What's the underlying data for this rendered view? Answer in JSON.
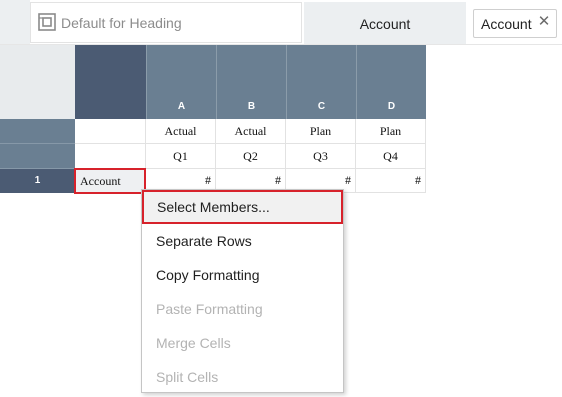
{
  "toolbar": {
    "format_label": "Default for Heading",
    "pov_tab_label": "Account",
    "pov_chip_label": "Account",
    "pov_chip_close": "✕"
  },
  "grid": {
    "column_letters": [
      "A",
      "B",
      "C",
      "D"
    ],
    "header_rows": [
      [
        "Actual",
        "Actual",
        "Plan",
        "Plan"
      ],
      [
        "Q1",
        "Q2",
        "Q3",
        "Q4"
      ]
    ],
    "rows": [
      {
        "number": "1",
        "member": "Account",
        "values": [
          "#",
          "#",
          "#",
          "#"
        ]
      }
    ]
  },
  "context_menu": {
    "items": [
      {
        "label": "Select Members...",
        "enabled": true,
        "highlighted": true
      },
      {
        "label": "Separate Rows",
        "enabled": true
      },
      {
        "label": "Copy Formatting",
        "enabled": true
      },
      {
        "label": "Paste Formatting",
        "enabled": false
      },
      {
        "label": "Merge Cells",
        "enabled": false
      },
      {
        "label": "Split Cells",
        "enabled": false
      }
    ]
  },
  "colors": {
    "highlight_border": "#d7222b",
    "header_slate": "#6a7f92",
    "header_navy": "#4b5b73",
    "toolbar_gray": "#eceff1"
  },
  "icons": {
    "format_icon": "format-frame-icon",
    "close_icon": "close-icon"
  }
}
